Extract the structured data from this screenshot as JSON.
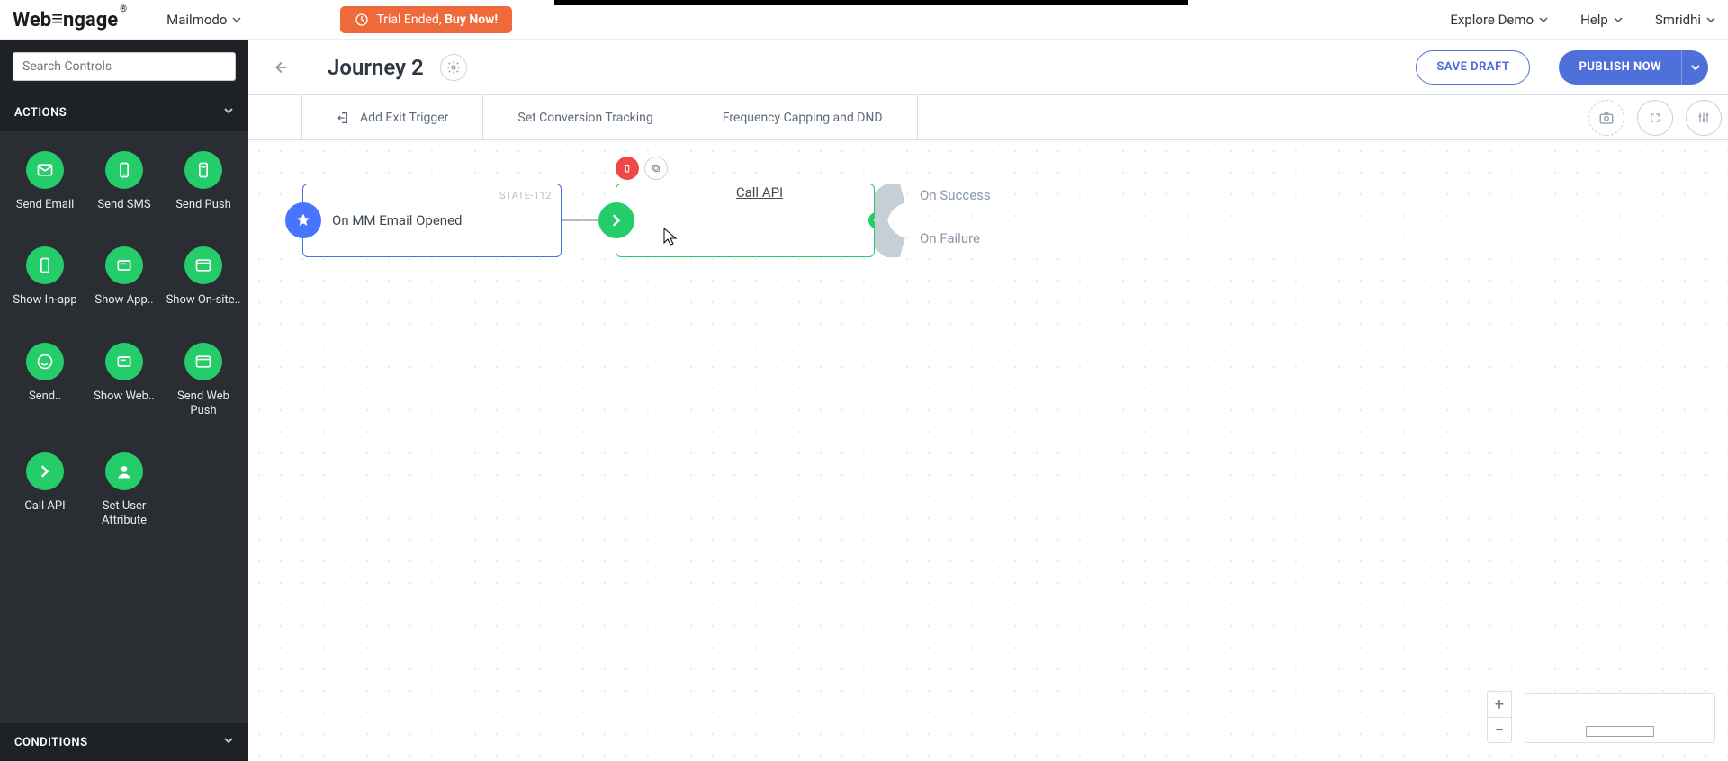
{
  "brand": "WebEngage",
  "workspace": {
    "name": "Mailmodo"
  },
  "trial": {
    "prefix": "Trial Ended, ",
    "cta": "Buy Now!",
    "bg": "#ef6a3a"
  },
  "nav": {
    "explore": "Explore Demo",
    "help": "Help",
    "user": "Smridhi"
  },
  "sidebar": {
    "search_placeholder": "Search Controls",
    "sections": {
      "actions": "ACTIONS",
      "conditions": "CONDITIONS"
    },
    "actions": [
      {
        "label": "Send Email"
      },
      {
        "label": "Send SMS"
      },
      {
        "label": "Send Push"
      },
      {
        "label": "Show In-app"
      },
      {
        "label": "Show App.."
      },
      {
        "label": "Show On-site.."
      },
      {
        "label": "Send.."
      },
      {
        "label": "Show Web.."
      },
      {
        "label": "Send Web Push"
      },
      {
        "label": "Call API"
      },
      {
        "label": "Set User Attribute"
      }
    ]
  },
  "journey": {
    "title": "Journey 2",
    "save": "SAVE DRAFT",
    "publish": "PUBLISH NOW"
  },
  "toolbar": {
    "add_exit": "Add Exit Trigger",
    "conversion": "Set Conversion Tracking",
    "freq": "Frequency Capping and DND"
  },
  "canvas": {
    "trigger": {
      "label": "On MM Email Opened",
      "state": "STATE-112"
    },
    "action": {
      "label": "Call API"
    },
    "outcomes": {
      "success": "On Success",
      "failure": "On Failure"
    }
  }
}
